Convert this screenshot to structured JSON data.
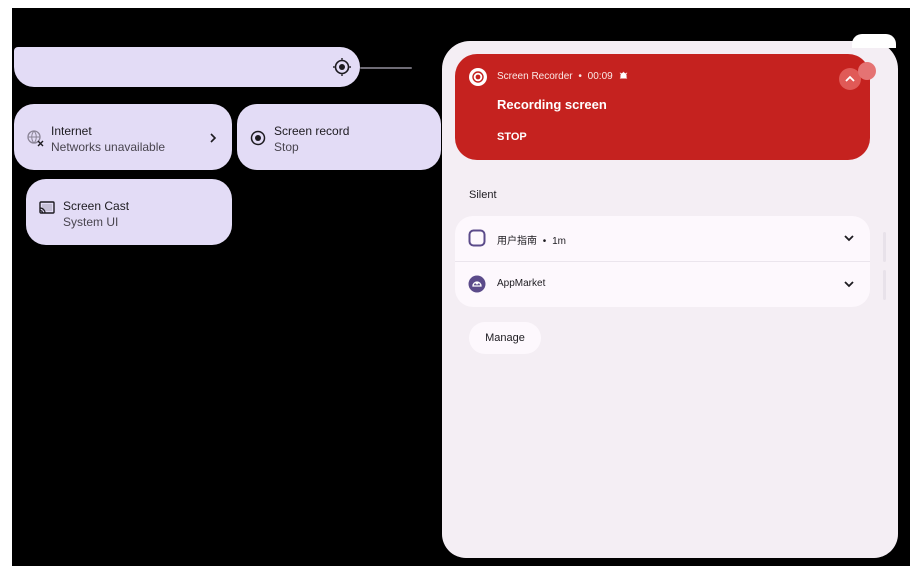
{
  "quick_settings": {
    "brightness": {
      "icon": "brightness-icon"
    },
    "tiles": [
      {
        "id": "internet",
        "label": "Internet",
        "subtitle": "Networks unavailable",
        "icon": "wifi-off-icon",
        "has_chevron": true
      },
      {
        "id": "screen-record",
        "label": "Screen record",
        "subtitle": "Stop",
        "icon": "screen-record-icon"
      },
      {
        "id": "screen-cast",
        "label": "Screen Cast",
        "subtitle": "System UI",
        "icon": "cast-icon"
      }
    ]
  },
  "notifications": {
    "recording": {
      "app": "Screen Recorder",
      "separator": "•",
      "elapsed": "00:09",
      "title": "Recording screen",
      "action": "STOP",
      "accent_color": "#c5221f"
    },
    "section_label": "Silent",
    "silent_items": [
      {
        "app": "用户指南",
        "separator": "•",
        "time": "1m",
        "icon": "app-square-icon"
      },
      {
        "app": "AppMarket",
        "icon": "app-market-icon"
      }
    ],
    "manage_label": "Manage"
  },
  "colors": {
    "tile_bg": "#e3dcf6",
    "shade_bg": "#f4eef4",
    "record_red": "#c5221f",
    "icon_purple": "#5b4b8a"
  }
}
